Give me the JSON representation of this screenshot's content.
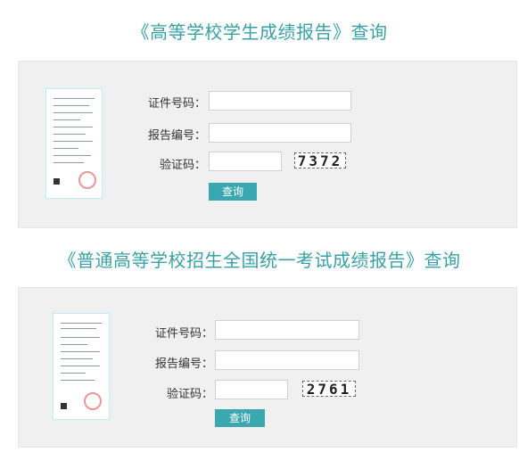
{
  "section1": {
    "title": "《高等学校学生成绩报告》查询",
    "fields": {
      "cert_label": "证件号码：",
      "report_label": "报告编号：",
      "captcha_label": "验证码："
    },
    "captcha_text": "7372",
    "query_label": "查询"
  },
  "section2": {
    "title": "《普通高等学校招生全国统一考试成绩报告》查询",
    "fields": {
      "cert_label": "证件号码：",
      "report_label": "报告编号：",
      "captcha_label": "验证码："
    },
    "captcha_text": "2761",
    "query_label": "查询"
  },
  "colors": {
    "accent": "#3aa0a3",
    "button": "#3aa7b1",
    "panel": "#f0f0f0"
  }
}
